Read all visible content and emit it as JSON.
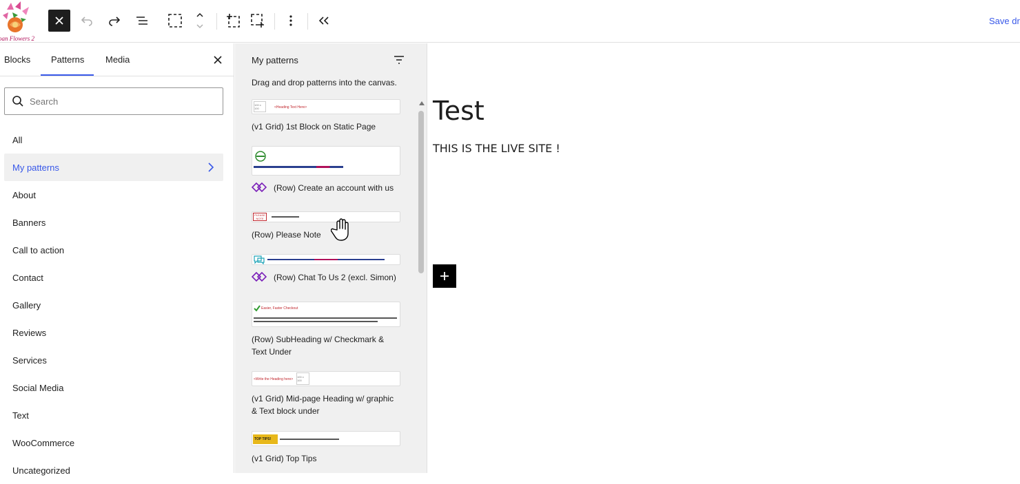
{
  "brand": {
    "logo_text": "oan Flowers 2"
  },
  "toolbar": {
    "save_label": "Save dra",
    "accent": "#3858e9"
  },
  "inserter": {
    "tabs": [
      {
        "label": "Blocks"
      },
      {
        "label": "Patterns",
        "active": true
      },
      {
        "label": "Media"
      }
    ],
    "search": {
      "placeholder": "Search",
      "value": ""
    },
    "categories": [
      {
        "label": "All"
      },
      {
        "label": "My patterns",
        "active": true
      },
      {
        "label": "About"
      },
      {
        "label": "Banners"
      },
      {
        "label": "Call to action"
      },
      {
        "label": "Contact"
      },
      {
        "label": "Gallery"
      },
      {
        "label": "Reviews"
      },
      {
        "label": "Services"
      },
      {
        "label": "Social Media"
      },
      {
        "label": "Text"
      },
      {
        "label": "WooCommerce"
      },
      {
        "label": "Uncategorized"
      }
    ]
  },
  "patterns": {
    "title": "My patterns",
    "description": "Drag and drop patterns into the canvas.",
    "items": [
      {
        "label": "(v1 Grid) 1st Block on Static Page",
        "synced": false,
        "thumb_text": "<Heading Text Here>",
        "thumb_box": "100 x 100"
      },
      {
        "label": "(Row) Create an account with us",
        "synced": true
      },
      {
        "label": "(Row) Please Note",
        "synced": false,
        "thumb_badge": "PLEASE NOTE"
      },
      {
        "label": "(Row) Chat To Us 2 (excl. Simon)",
        "synced": true
      },
      {
        "label": "(Row) SubHeading w/ Checkmark & Text Under",
        "synced": false,
        "thumb_text": "Easier, Faster Checkout"
      },
      {
        "label": "(v1 Grid) Mid-page Heading w/ graphic & Text block under",
        "synced": false,
        "thumb_text": "<Write the Heading here>",
        "thumb_box": "100 x 100"
      },
      {
        "label": "(v1 Grid) Top Tips",
        "synced": false,
        "thumb_badge": "TOP TIPS!"
      }
    ]
  },
  "canvas": {
    "title": "Test",
    "paragraph": "THIS IS THE LIVE SITE !"
  }
}
